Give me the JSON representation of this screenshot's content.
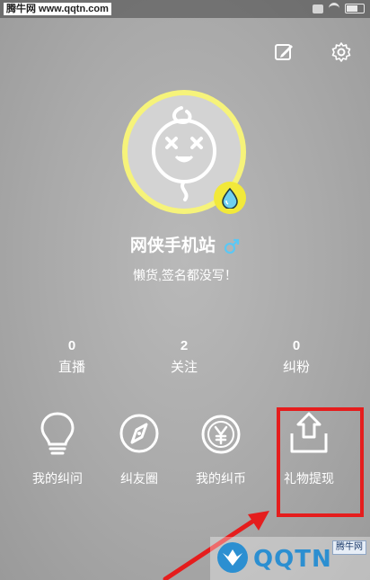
{
  "status_bar": {
    "watermark_label": "腾牛网 www.qqtn.com"
  },
  "profile": {
    "name": "网侠手机站",
    "signature": "懒货,签名都没写！"
  },
  "stats": [
    {
      "count": "0",
      "label": "直播"
    },
    {
      "count": "2",
      "label": "关注"
    },
    {
      "count": "0",
      "label": "纠粉"
    }
  ],
  "menu": [
    {
      "label": "我的纠问",
      "icon": "lightbulb-icon"
    },
    {
      "label": "纠友圈",
      "icon": "compass-icon"
    },
    {
      "label": "我的纠币",
      "icon": "yen-coin-icon"
    },
    {
      "label": "礼物提现",
      "icon": "upload-tray-icon"
    }
  ],
  "watermark": {
    "brand": "QQTN",
    "badge": "腾牛网"
  },
  "colors": {
    "highlight": "#e51d1d",
    "avatar_ring": "#f6f37a",
    "gender_icon": "#5bc8f5"
  }
}
